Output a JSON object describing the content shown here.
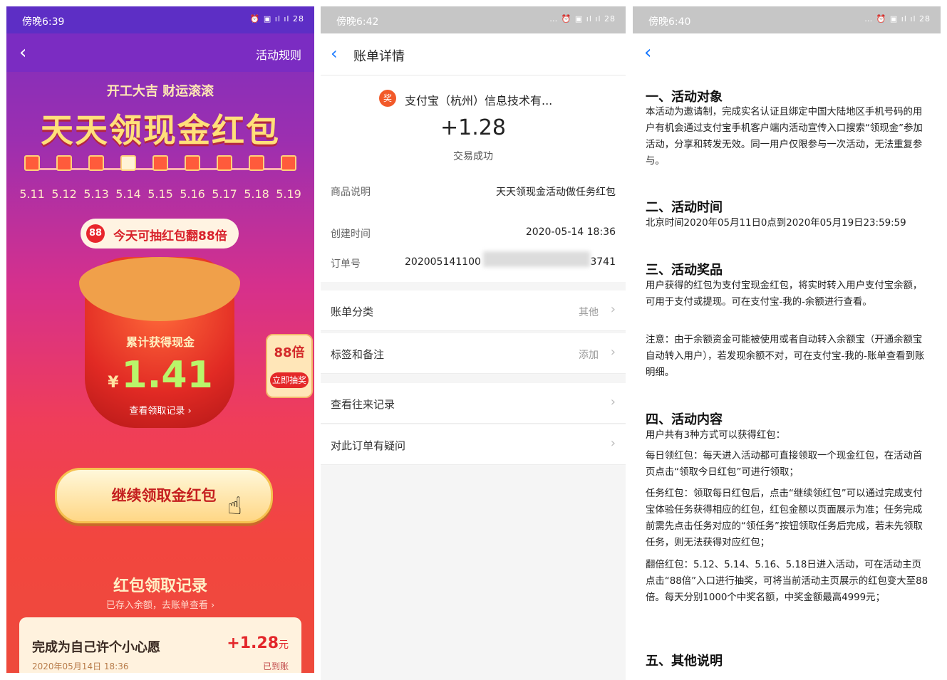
{
  "panel1": {
    "status_time": "傍晚6:39",
    "status_icons": "⏰ ▣ ıl ıl 28",
    "back_icon": "chevron-left-icon",
    "rules_label": "活动规则",
    "subtitle": "开工大吉 财运滚滚",
    "title": "天天领现金红包",
    "dates": [
      "5.11",
      "5.12",
      "5.13",
      "5.14",
      "5.15",
      "5.16",
      "5.17",
      "5.18",
      "5.19"
    ],
    "checked_index": 3,
    "badge_num": "88",
    "today_text": "今天可抽红包翻88倍",
    "bag_label": "累计获得现金",
    "currency": "¥",
    "amount": "1.41",
    "view_record": "查看领取记录 ›",
    "side_multiplier": "88倍",
    "side_button": "立即抽奖",
    "cta_label": "继续领取金红包",
    "record_title": "红包领取记录",
    "record_sub": "已存入余额，去账单查看 ›",
    "record": {
      "wish": "完成为自己许个小心愿",
      "amount": "+1.28",
      "unit": "元",
      "date": "2020年05月14日 18:36",
      "status": "已到账"
    }
  },
  "panel2": {
    "status_time": "傍晚6:42",
    "status_icons": "… ⏰ ▣ ıl ıl 28",
    "title": "账单详情",
    "merchant_badge": "奖",
    "merchant": "支付宝（杭州）信息技术有...",
    "amount": "+1.28",
    "state": "交易成功",
    "desc_key": "商品说明",
    "desc_val": "天天领现金活动做任务红包",
    "created_key": "创建时间",
    "created_val": "2020-05-14 18:36",
    "order_key": "订单号",
    "order_val_start": "202005141100",
    "order_val_end": "3741",
    "links": [
      {
        "key": "账单分类",
        "value": "其他"
      },
      {
        "key": "标签和备注",
        "value": "添加"
      },
      {
        "key": "查看往来记录",
        "value": ""
      },
      {
        "key": "对此订单有疑问",
        "value": ""
      }
    ]
  },
  "panel3": {
    "status_time": "傍晚6:40",
    "status_icons": "… ⏰ ▣ ıl ıl 28",
    "h1": "一、活动对象",
    "p1": "本活动为邀请制，完成实名认证且绑定中国大陆地区手机号码的用户有机会通过支付宝手机客户端内活动宣传入口搜索“领现金”参加活动，分享和转发无效。同一用户仅限参与一次活动，无法重复参与。",
    "h2": "二、活动时间",
    "p2": "北京时间2020年05月11日0点到2020年05月19日23:59:59",
    "h3": "三、活动奖品",
    "p3": "用户获得的红包为支付宝现金红包，将实时转入用户支付宝余额，可用于支付或提现。可在支付宝-我的-余额进行查看。",
    "p3b": "注意：由于余额资金可能被使用或者自动转入余额宝（开通余额宝自动转入用户），若发现余额不对，可在支付宝-我的-账单查看到账明细。",
    "h4": "四、活动内容",
    "p4": "用户共有3种方式可以获得红包：",
    "p4a": "每日领红包：每天进入活动都可直接领取一个现金红包，在活动首页点击“领取今日红包”可进行领取；",
    "p4b": "任务红包：领取每日红包后，点击“继续领红包”可以通过完成支付宝体验任务获得相应的红包，红包金额以页面展示为准；任务完成前需先点击任务对应的“领任务”按钮领取任务后完成，若未先领取任务，则无法获得对应红包；",
    "p4c": "翻倍红包：5.12、5.14、5.16、5.18日进入活动，可在活动主页点击“88倍”入口进行抽奖，可将当前活动主页展示的红包变大至88倍。每天分别1000个中奖名额，中奖金额最高4999元；",
    "h5": "五、其他说明"
  }
}
